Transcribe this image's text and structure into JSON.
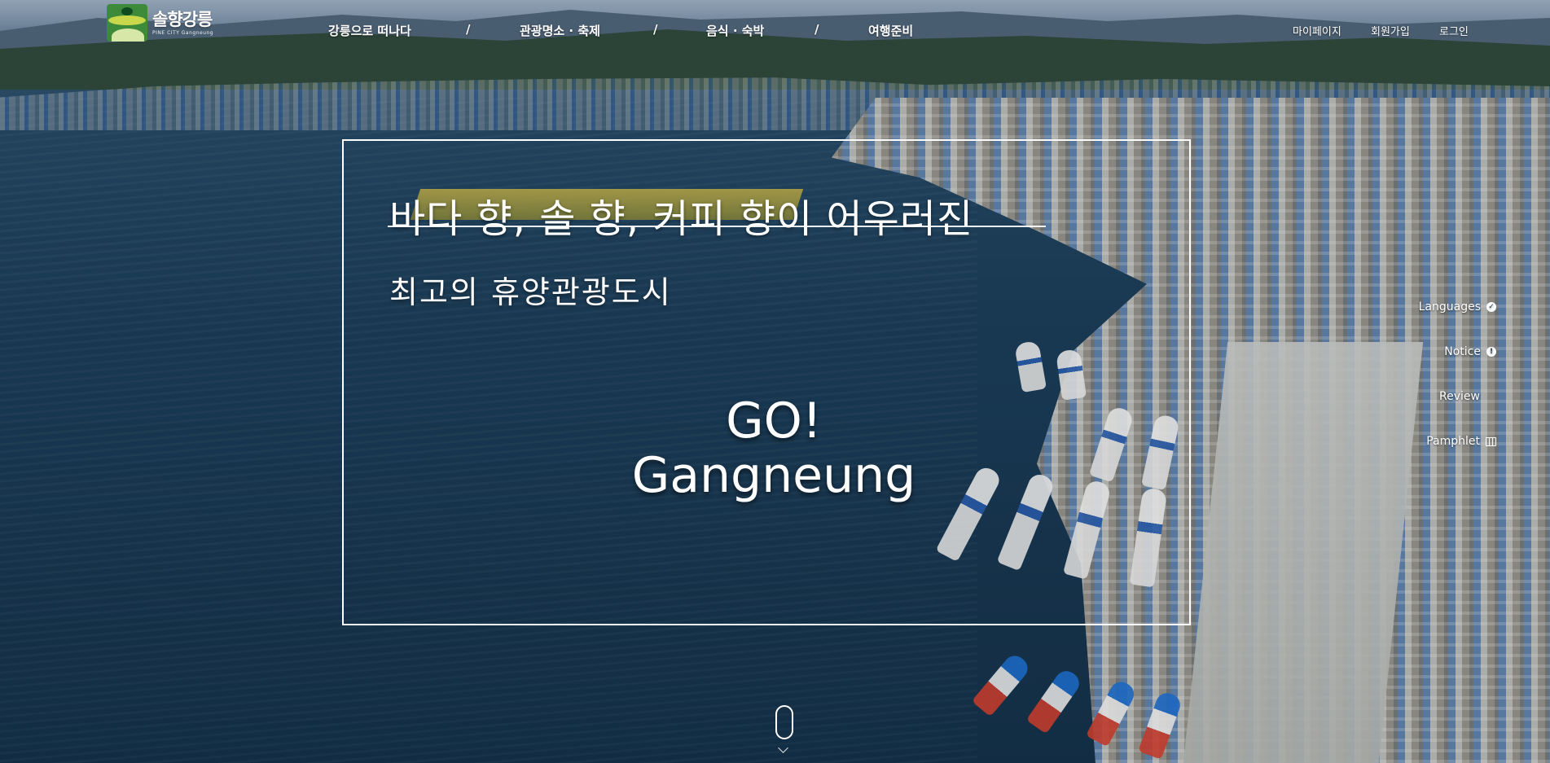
{
  "logo": {
    "title": "솔향강릉",
    "subtitle": "PINE CITY Gangneung"
  },
  "nav": {
    "items": [
      {
        "label": "강릉으로 떠나다"
      },
      {
        "label": "관광명소 · 축제"
      },
      {
        "label": "음식 · 숙박"
      },
      {
        "label": "여행준비"
      }
    ],
    "separator": "/"
  },
  "util": {
    "mypage": "마이페이지",
    "join": "회원가입",
    "login": "로그인"
  },
  "hero": {
    "headline": "바다 향, 솔 향, 커피 향이 어우러진",
    "subhead": "최고의 휴양관광도시",
    "go_line1": "GO!",
    "go_line2": "Gangneung"
  },
  "quick_menu": [
    {
      "label": "Languages",
      "icon": "globe-icon"
    },
    {
      "label": "Notice",
      "icon": "info-icon"
    },
    {
      "label": "Review",
      "icon": "none"
    },
    {
      "label": "Pamphlet",
      "icon": "map-icon"
    }
  ],
  "colors": {
    "text": "#ffffff",
    "water": "#1c3e5a"
  }
}
